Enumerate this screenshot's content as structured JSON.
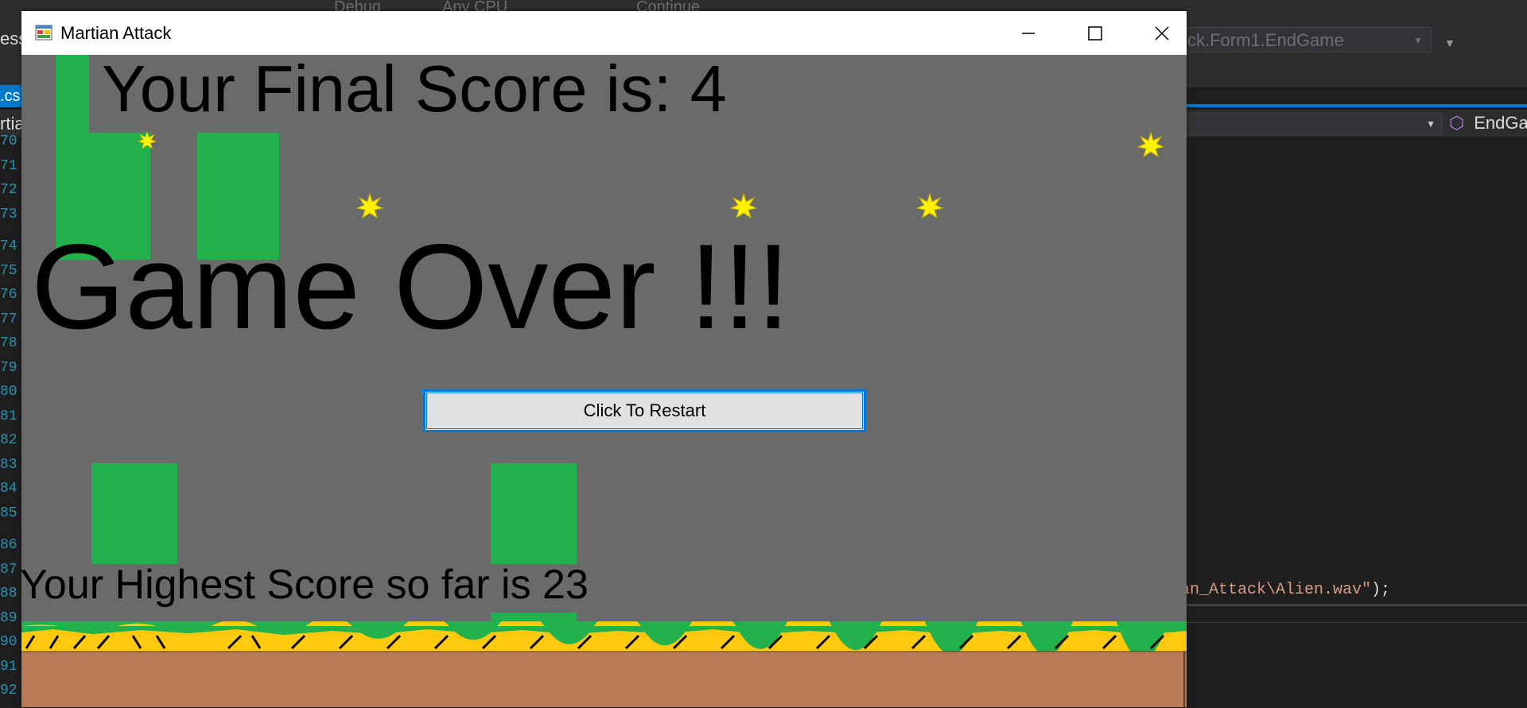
{
  "ide": {
    "toolbar_items": [
      "Debug",
      "Any CPU",
      "Continue"
    ],
    "combo_text": "ck.Form1.EndGame",
    "left_tab_text": ".cs",
    "left_nav_text": "rtia",
    "left_side_text": "ess",
    "member_text": "EndGa",
    "line_numbers": [
      "70",
      "71",
      "72",
      "73",
      "74",
      "75",
      "76",
      "77",
      "78",
      "79",
      "80",
      "81",
      "82",
      "83",
      "84",
      "85",
      "86",
      "87",
      "88",
      "89",
      "90",
      "91",
      "92"
    ],
    "code_fragment": "an_Attack\\Alien.wav\"",
    "code_tail": ");"
  },
  "window": {
    "title": "Martian Attack",
    "minimize_label": "Minimize",
    "maximize_label": "Maximize",
    "close_label": "Close"
  },
  "game": {
    "final_score_text": "Your Final Score is: 4",
    "game_over_text": "Game Over !!!",
    "restart_button_label": "Click To Restart",
    "highest_score_text": "Your Highest Score so far is 23",
    "colors": {
      "background": "#6a6a6a",
      "pillar": "#22b14c",
      "star": "#fff200",
      "ground_stripe": "#ffc90e",
      "ground_dirt": "#b97a57",
      "button_border": "#0078d7"
    }
  }
}
